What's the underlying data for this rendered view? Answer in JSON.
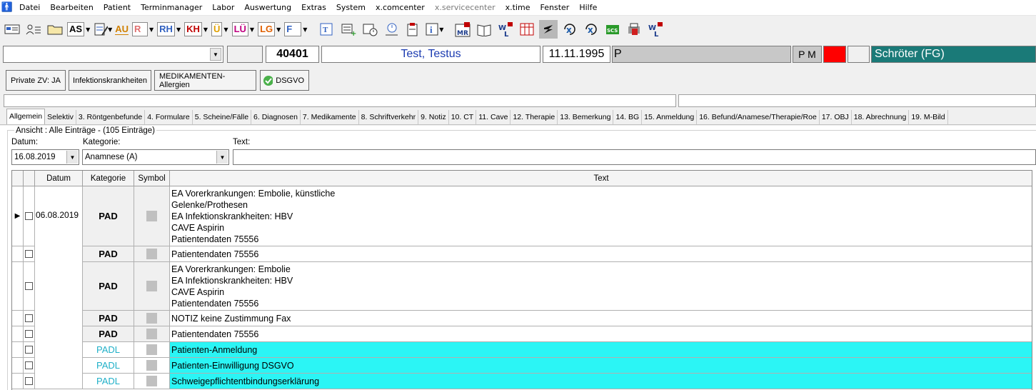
{
  "menu": [
    "Datei",
    "Bearbeiten",
    "Patient",
    "Terminmanager",
    "Labor",
    "Auswertung",
    "Extras",
    "System",
    "x.comcenter",
    "x.servicecenter",
    "x.time",
    "Fenster",
    "Hilfe"
  ],
  "toolbar": {
    "as": "AS",
    "au": "AU",
    "r": "R",
    "rh": "RH",
    "kh": "KH",
    "u": "Ü",
    "lu": "LÜ",
    "lg": "LG",
    "f": "F"
  },
  "patient": {
    "number": "40401",
    "name": "Test, Testus",
    "dob": "11.11.1995",
    "status": "P",
    "initials": "P M",
    "doctor": "Schröter (FG)",
    "doctor_color": "#1a7a78"
  },
  "buttons": {
    "private": "Private ZV: JA",
    "infekt": "Infektionskrankheiten",
    "allergien": "MEDIKAMENTEN-Allergien",
    "dsgvo": "DSGVO"
  },
  "tabs": [
    "Allgemein",
    "Selektiv",
    "3. Röntgenbefunde",
    "4. Formulare",
    "5. Scheine/Fälle",
    "6. Diagnosen",
    "7. Medikamente",
    "8. Schriftverkehr",
    "9. Notiz",
    "10. CT",
    "11. Cave",
    "12. Therapie",
    "13. Bemerkung",
    "14. BG",
    "15. Anmeldung",
    "16. Befund/Anamese/Therapie/Roe",
    "17. OBJ",
    "18. Abrechnung",
    "19. M-Bild"
  ],
  "view": {
    "title": "Ansicht : Alle Einträge - (105 Einträge)",
    "datum_label": "Datum:",
    "kategorie_label": "Kategorie:",
    "text_label": "Text:",
    "datum_value": "16.08.2019",
    "kategorie_value": "Anamnese (A)",
    "text_value": ""
  },
  "grid": {
    "headers": {
      "datum": "Datum",
      "kategorie": "Kategorie",
      "symbol": "Symbol",
      "text": "Text"
    },
    "date": "06.08.2019",
    "rows": [
      {
        "kat": "PAD",
        "text": "EA Vorerkrankungen: Embolie, künstliche\nGelenke/Prothesen\nEA Infektionskrankheiten: HBV\nCAVE Aspirin\nPatientendaten 75556"
      },
      {
        "kat": "PAD",
        "text": "Patientendaten 75556"
      },
      {
        "kat": "PAD",
        "text": "EA Vorerkrankungen: Embolie\nEA Infektionskrankheiten: HBV\nCAVE Aspirin\nPatientendaten 75556"
      },
      {
        "kat": "PAD",
        "text": "NOTIZ keine Zustimmung Fax"
      },
      {
        "kat": "PAD",
        "text": "Patientendaten 75556"
      },
      {
        "kat": "PADL",
        "text": "Patienten-Anmeldung"
      },
      {
        "kat": "PADL",
        "text": "Patienten-Einwilligung DSGVO"
      },
      {
        "kat": "PADL",
        "text": "Schweigepflichtentbindungserklärung"
      }
    ]
  }
}
